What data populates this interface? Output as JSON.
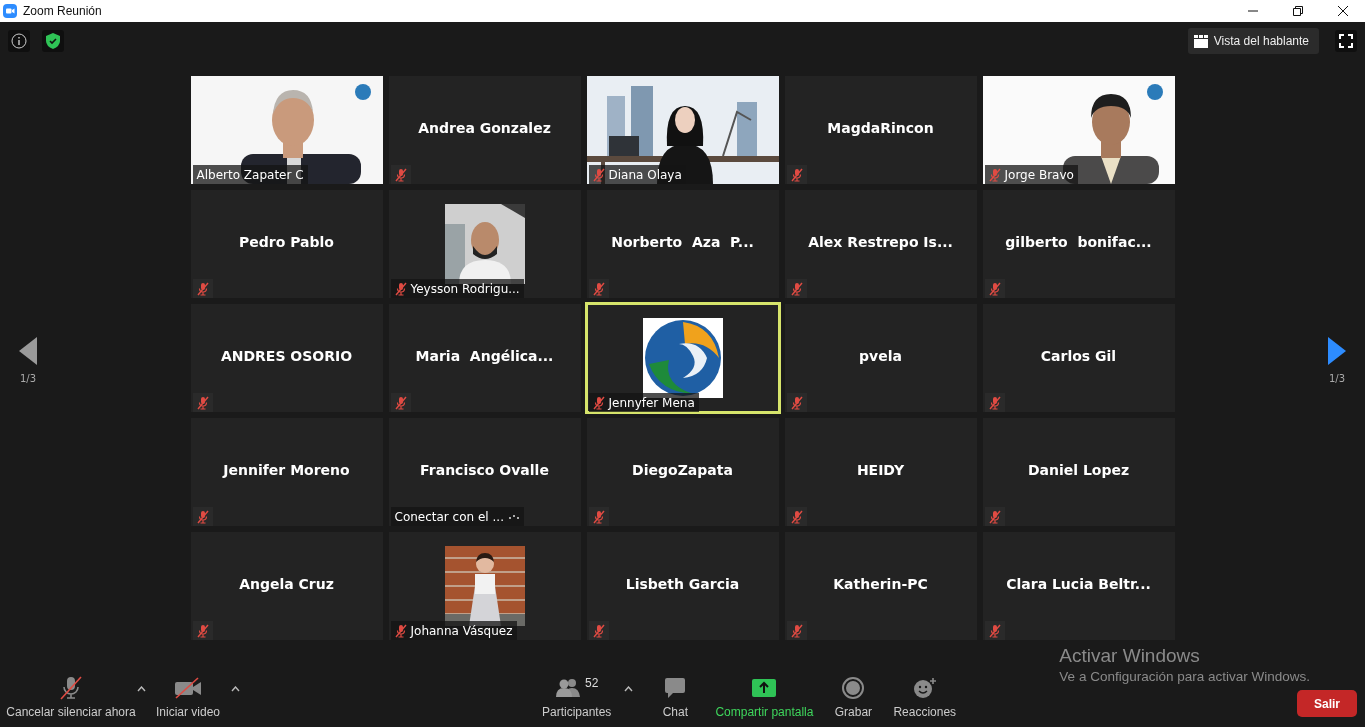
{
  "window": {
    "title": "Zoom Reunión"
  },
  "top_bar": {
    "view_button": "Vista del hablante"
  },
  "pager": {
    "prev": {
      "page": "1/3",
      "disabled": true
    },
    "next": {
      "page": "1/3",
      "disabled": false
    }
  },
  "tiles": [
    {
      "kind": "video",
      "name": "Alberto Zapater C",
      "muted": false,
      "speaking": false
    },
    {
      "kind": "name",
      "name": "Andrea Gonzalez",
      "muted": true,
      "speaking": false
    },
    {
      "kind": "video",
      "name": "Diana Olaya",
      "muted": true,
      "speaking": false
    },
    {
      "kind": "name",
      "name": "MagdaRincon",
      "muted": true,
      "speaking": false
    },
    {
      "kind": "video",
      "name": "Jorge Bravo",
      "muted": true,
      "speaking": false
    },
    {
      "kind": "name",
      "name": "Pedro Pablo",
      "muted": true,
      "speaking": false
    },
    {
      "name": "Yeysson Rodrigu...",
      "muted": true,
      "speaking": false
    },
    {
      "kind": "name",
      "name": "Norberto  Aza  P...",
      "muted": true,
      "speaking": false
    },
    {
      "kind": "name",
      "name": "Alex Restrepo Is...",
      "muted": true,
      "speaking": false
    },
    {
      "kind": "name",
      "name": "gilberto  bonifac...",
      "muted": true,
      "speaking": false
    },
    {
      "kind": "name",
      "name": "ANDRES OSORIO",
      "muted": true,
      "speaking": false
    },
    {
      "kind": "name",
      "name": "Maria  Angélica...",
      "muted": true,
      "speaking": false
    },
    {
      "name": "Jennyfer Mena",
      "muted": true,
      "speaking": true
    },
    {
      "kind": "name",
      "name": "pvela",
      "muted": true,
      "speaking": false
    },
    {
      "kind": "name",
      "name": "Carlos Gil",
      "muted": true,
      "speaking": false
    },
    {
      "kind": "name",
      "name": "Jennifer Moreno",
      "muted": true,
      "speaking": false
    },
    {
      "kind": "name",
      "name": "Francisco Ovalle",
      "muted": false,
      "speaking": false,
      "status": "Conectar con el ..."
    },
    {
      "kind": "name",
      "name": "DiegoZapata",
      "muted": true,
      "speaking": false
    },
    {
      "kind": "name",
      "name": "HEIDY",
      "muted": true,
      "speaking": false
    },
    {
      "kind": "name",
      "name": "Daniel Lopez",
      "muted": true,
      "speaking": false
    },
    {
      "kind": "name",
      "name": "Angela Cruz",
      "muted": true,
      "speaking": false
    },
    {
      "name": "Johanna Vásquez",
      "muted": true,
      "speaking": false
    },
    {
      "kind": "name",
      "name": "Lisbeth Garcia",
      "muted": true,
      "speaking": false
    },
    {
      "kind": "name",
      "name": "Katherin-PC",
      "muted": true,
      "speaking": false
    },
    {
      "kind": "name",
      "name": "Clara Lucia Beltr...",
      "muted": true,
      "speaking": false
    }
  ],
  "toolbar": {
    "left": [
      {
        "kind": "mic",
        "label": "Cancelar silenciar ahora"
      },
      {
        "kind": "video",
        "label": "Iniciar video"
      }
    ],
    "center": [
      {
        "kind": "participants",
        "label": "Participantes",
        "count": "52"
      },
      {
        "kind": "chat",
        "label": "Chat"
      },
      {
        "kind": "share",
        "label": "Compartir pantalla"
      },
      {
        "kind": "record",
        "label": "Grabar"
      },
      {
        "kind": "reactions",
        "label": "Reacciones"
      }
    ],
    "leave": "Salir"
  },
  "windows_activation": {
    "title": "Activar Windows",
    "text": "Ve a Configuración para activar Windows."
  }
}
